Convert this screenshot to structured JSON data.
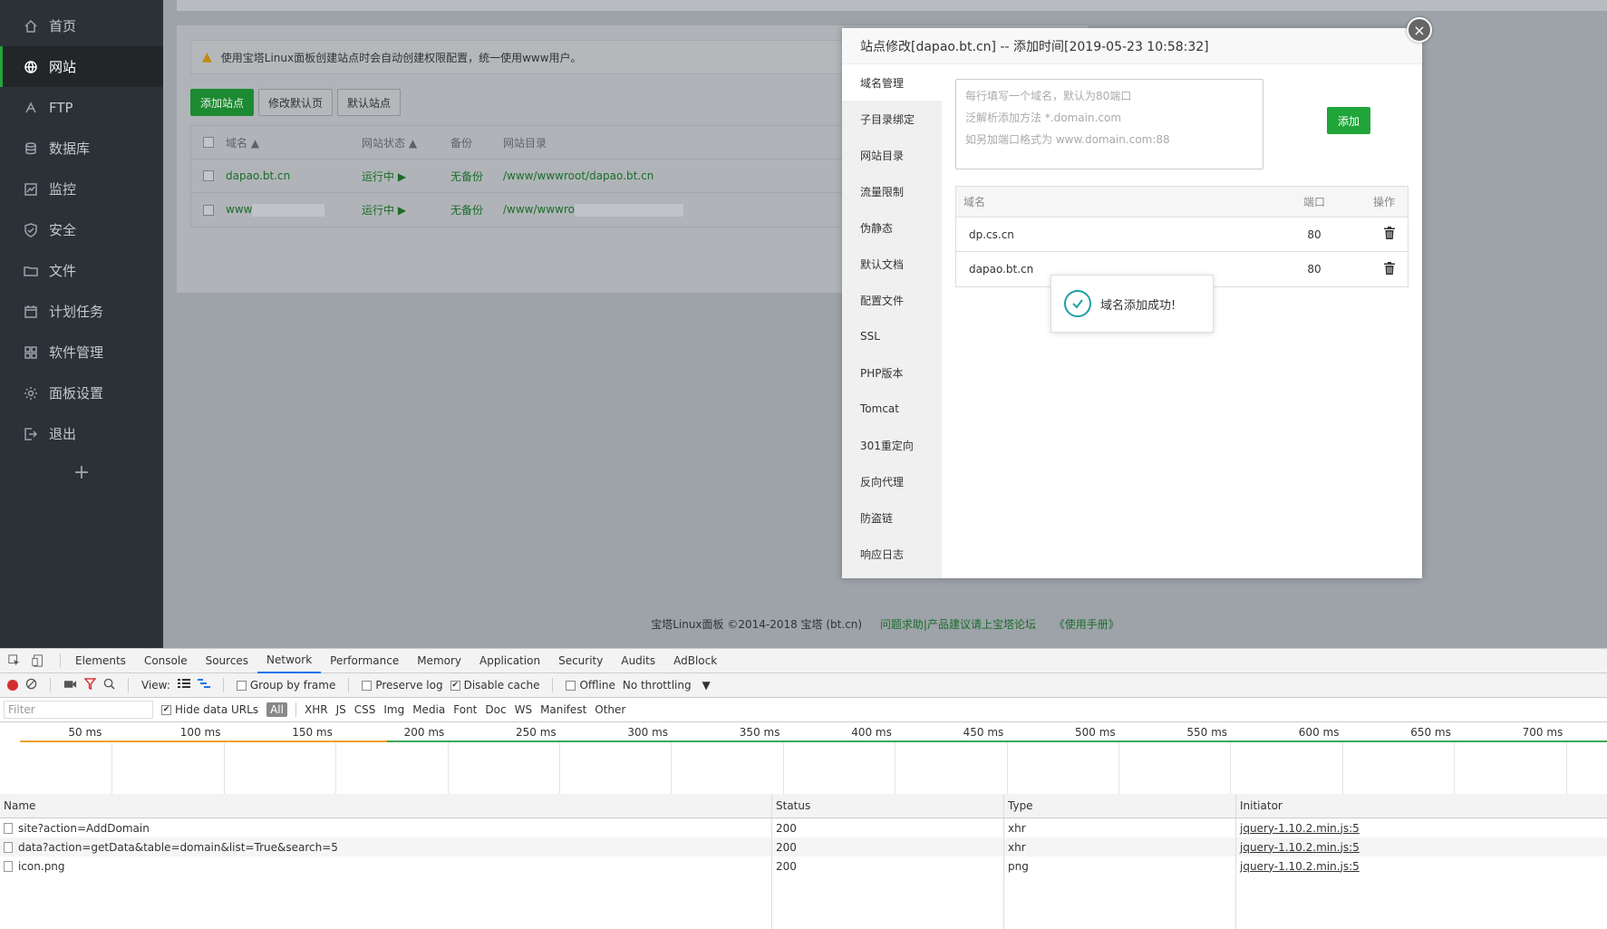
{
  "sidebar": {
    "items": [
      {
        "label": "首页",
        "icon": "home-icon"
      },
      {
        "label": "网站",
        "icon": "globe-icon",
        "active": true
      },
      {
        "label": "FTP",
        "icon": "ftp-icon"
      },
      {
        "label": "数据库",
        "icon": "database-icon"
      },
      {
        "label": "监控",
        "icon": "monitor-icon"
      },
      {
        "label": "安全",
        "icon": "shield-icon"
      },
      {
        "label": "文件",
        "icon": "folder-icon"
      },
      {
        "label": "计划任务",
        "icon": "calendar-icon"
      },
      {
        "label": "软件管理",
        "icon": "grid-icon"
      },
      {
        "label": "面板设置",
        "icon": "gear-icon"
      },
      {
        "label": "退出",
        "icon": "logout-icon"
      }
    ],
    "add_symbol": "+"
  },
  "main": {
    "alert_text": "使用宝塔Linux面板创建站点时会自动创建权限配置，统一使用www用户。",
    "buttons": {
      "add_site": "添加站点",
      "edit_default_page": "修改默认页",
      "default_site": "默认站点"
    },
    "table": {
      "headers": {
        "name": "域名 ▲",
        "status": "网站状态 ▲",
        "backup": "备份",
        "dir": "网站目录"
      },
      "rows": [
        {
          "name": "dapao.bt.cn",
          "status": "运行中 ▶",
          "backup": "无备份",
          "dir": "/www/wwwroot/dapao.bt.cn"
        },
        {
          "name": "www",
          "status": "运行中 ▶",
          "backup": "无备份",
          "dir": "/www/wwwro"
        }
      ]
    }
  },
  "footer": {
    "copyright": "宝塔Linux面板 ©2014-2018 宝塔 (bt.cn)",
    "forum_link": "问题求助|产品建议请上宝塔论坛",
    "manual_link": "《使用手册》"
  },
  "modal": {
    "title": "站点修改[dapao.bt.cn] -- 添加时间[2019-05-23 10:58:32]",
    "close_symbol": "×",
    "tabs": [
      "域名管理",
      "子目录绑定",
      "网站目录",
      "流量限制",
      "伪静态",
      "默认文档",
      "配置文件",
      "SSL",
      "PHP版本",
      "Tomcat",
      "301重定向",
      "反向代理",
      "防盗链",
      "响应日志"
    ],
    "input_placeholder_lines": [
      "每行填写一个域名，默认为80端口",
      "泛解析添加方法 *.domain.com",
      "如另加端口格式为 www.domain.com:88"
    ],
    "add_label": "添加",
    "domain_table": {
      "headers": {
        "name": "域名",
        "port": "端口",
        "op": "操作"
      },
      "rows": [
        {
          "name": "dp.cs.cn",
          "port": "80"
        },
        {
          "name": "dapao.bt.cn",
          "port": "80"
        }
      ]
    },
    "toast": "域名添加成功!"
  },
  "devtools": {
    "tabs": [
      "Elements",
      "Console",
      "Sources",
      "Network",
      "Performance",
      "Memory",
      "Application",
      "Security",
      "Audits",
      "AdBlock"
    ],
    "active_tab": "Network",
    "toolbar": {
      "view_label": "View:",
      "group_by_frame": "Group by frame",
      "preserve_log": "Preserve log",
      "disable_cache": "Disable cache",
      "offline": "Offline",
      "throttling": "No throttling"
    },
    "filter": {
      "placeholder": "Filter",
      "hide_data_urls": "Hide data URLs",
      "types": [
        "All",
        "XHR",
        "JS",
        "CSS",
        "Img",
        "Media",
        "Font",
        "Doc",
        "WS",
        "Manifest",
        "Other"
      ]
    },
    "timeline_labels": [
      "50 ms",
      "100 ms",
      "150 ms",
      "200 ms",
      "250 ms",
      "300 ms",
      "350 ms",
      "400 ms",
      "450 ms",
      "500 ms",
      "550 ms",
      "600 ms",
      "650 ms",
      "700 ms"
    ],
    "columns": {
      "name": "Name",
      "status": "Status",
      "type": "Type",
      "initiator": "Initiator"
    },
    "requests": [
      {
        "name": "site?action=AddDomain",
        "status": "200",
        "type": "xhr",
        "initiator": "jquery-1.10.2.min.js:5"
      },
      {
        "name": "data?action=getData&table=domain&list=True&search=5",
        "status": "200",
        "type": "xhr",
        "initiator": "jquery-1.10.2.min.js:5"
      },
      {
        "name": "icon.png",
        "status": "200",
        "type": "png",
        "initiator": "jquery-1.10.2.min.js:5"
      }
    ]
  }
}
